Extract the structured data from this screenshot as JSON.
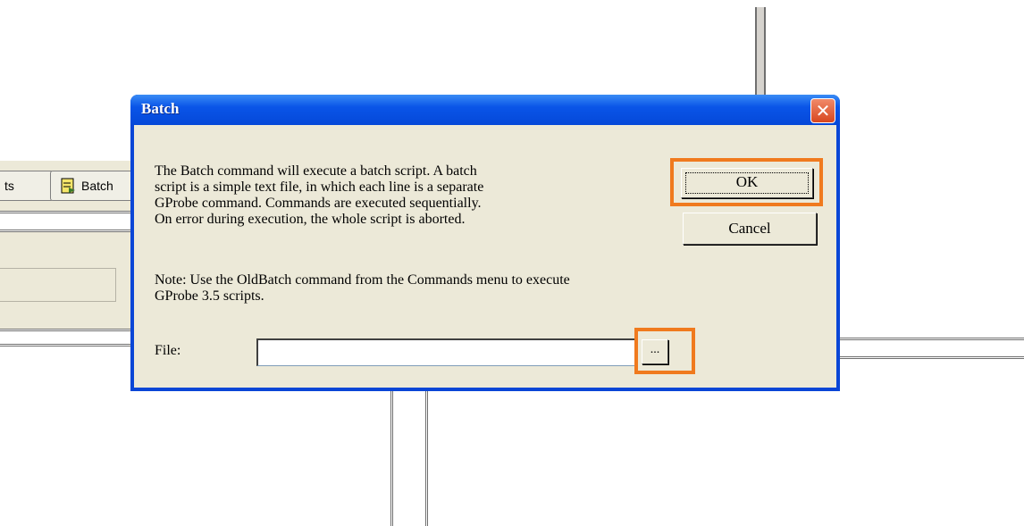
{
  "background_window": {
    "tab_partial_label": "ts",
    "batch_tab_label": "Batch"
  },
  "dialog": {
    "title": "Batch",
    "close_glyph": "✕",
    "description_lines": [
      "The Batch command will execute a batch script. A batch",
      "script is a simple text file, in which each line is a separate",
      "GProbe command. Commands are executed sequentially.",
      "On error during execution, the whole script is aborted."
    ],
    "note_lines": [
      "Note:  Use the OldBatch command from the Commands menu to execute",
      "GProbe 3.5 scripts."
    ],
    "file_label": "File:",
    "file_value": "",
    "ok_label": "OK",
    "cancel_label": "Cancel",
    "browse_label": "..."
  },
  "colors": {
    "highlight": "#f07a1e",
    "titlebar": "#0a55e8",
    "dialog_face": "#ece9d8"
  }
}
